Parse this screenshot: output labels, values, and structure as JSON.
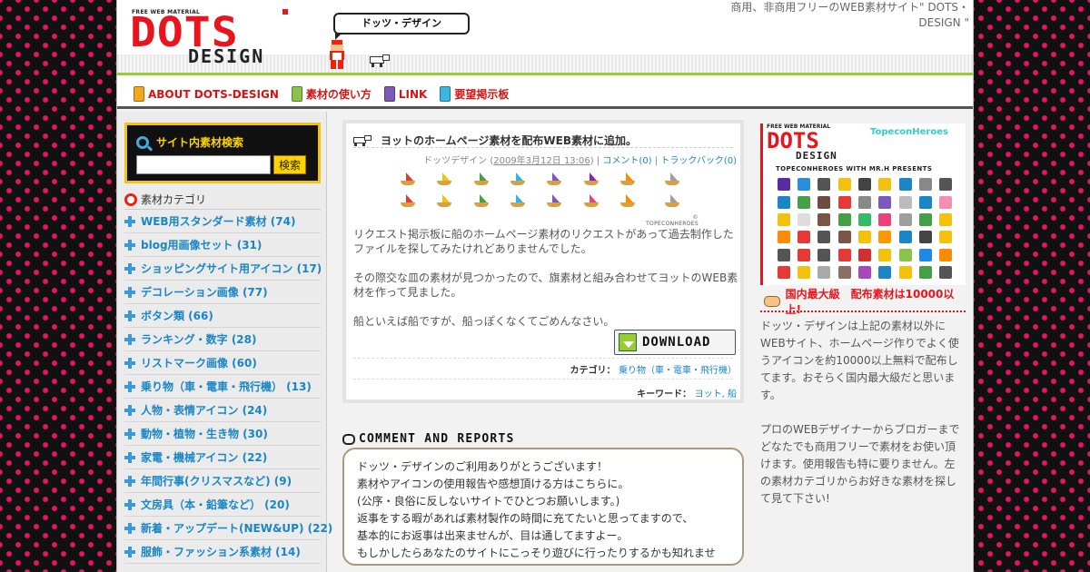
{
  "header": {
    "logo_small": "FREE WEB MATERIAL",
    "logo_main": "DOTS",
    "logo_sub": "DESIGN",
    "bubble": "ドッツ・デザイン",
    "tagline": "商用、非商用フリーのWEB素材サイト\" DOTS・DESIGN \""
  },
  "nav": [
    {
      "label": "ABOUT DOTS-DESIGN",
      "color": "#f2a81c"
    },
    {
      "label": "素材の使い方",
      "color": "#8bc34a"
    },
    {
      "label": "LINK",
      "color": "#7d5ab5"
    },
    {
      "label": "要望掲示板",
      "color": "#3cb5e0"
    }
  ],
  "sidebar": {
    "search_title": "サイト内素材検索",
    "search_value": "",
    "search_button": "検索",
    "category_title": "素材カテゴリ",
    "categories": [
      "WEB用スタンダード素材 (74)",
      "blog用画像セット (31)",
      "ショッピングサイト用アイコン (17)",
      "デコレーション画像 (77)",
      "ボタン類 (66)",
      "ランキング・数字 (28)",
      "リストマーク画像 (60)",
      "乗り物（車・電車・飛行機） (13)",
      "人物・表情アイコン (24)",
      "動物・植物・生き物 (30)",
      "家電・機械アイコン (22)",
      "年間行事(クリスマスなど) (9)",
      "文房具（本・鉛筆など） (20)",
      "新着・アップデート(NEW&UP) (22)",
      "服飾・ファッション系素材 (14)"
    ]
  },
  "post": {
    "title": "ヨットのホームページ素材を配布WEB素材に追加。",
    "author": "ドッツデザイン",
    "date": "2009年3月12日 13:06",
    "comments": "コメント(0)",
    "trackback": "トラックバック(0)",
    "boats_credit": "© TOPECONHEROES",
    "boats": [
      "#e53935",
      "#f4c20d",
      "#43a047",
      "#29b6f6",
      "#7e57c2",
      "#8e24aa",
      "#fb8c00",
      "#9e9e9e",
      "#e53935",
      "#f4c20d",
      "#43a047",
      "#29b6f6",
      "#7e57c2",
      "#ec407a",
      "#fb8c00",
      "#9e9e9e"
    ],
    "paragraphs": [
      "リクエスト掲示板に船のホームページ素材のリクエストがあって過去制作したファイルを探してみたけれどありませんでした。",
      "その際交な皿の素材が見つかったので、旗素材と組み合わせてヨットのWEB素材を作って見ました。",
      "船といえば船ですが、船っぽくなくてごめんなさい。"
    ],
    "download": "DOWNLOAD",
    "category_label": "カテゴリ：",
    "category_value": "乗り物（車・電車・飛行機）",
    "keyword_label": "キーワード：",
    "keywords": "ヨット, 船"
  },
  "comment": {
    "heading": "COMMENT AND REPORTS",
    "lines": [
      "ドッツ・デザインのご利用ありがとうございます！",
      "素材やアイコンの使用報告や感想頂ける方はこちらに。",
      "(公序・良俗に反しないサイトでひとつお願いします。)",
      "返事をする暇があれば素材製作の時間に充てたいと思ってますので、",
      "基本的にお返事は出来ませんが、目は通してますよー。",
      "もしかしたらあなたのサイトにこっそり遊びに行ったりするかも知れませ"
    ]
  },
  "right": {
    "banner_small": "FREE WEB MATERIAL",
    "banner_logo": "DOTS",
    "banner_sub": "DESIGN",
    "topecon": "TopeconHeroes",
    "presents": "TOPECONHEROES WITH MR.H PRESENTS",
    "icon_colors": [
      "#5b2ca0",
      "#2a8fd8",
      "#555",
      "#f4c20d",
      "#444",
      "#f4c20d",
      "#1a86c6",
      "#888",
      "#555",
      "#1a86c6",
      "#43a047",
      "#6d4c41",
      "#e53935",
      "#888",
      "#7e57c2",
      "#bbb",
      "#1a86c6",
      "#f48fb1",
      "#f4c20d",
      "#ddd",
      "#795548",
      "#43a047",
      "#3b6",
      "#ec407a",
      "#9e9e9e",
      "#43a047",
      "#f4c20d",
      "#fb8c00",
      "#e53935",
      "#555",
      "#795548",
      "#f4c20d",
      "#ff9800",
      "#1a86c6",
      "#444",
      "#f4c20d",
      "#555",
      "#e53935",
      "#555",
      "#e53935",
      "#d32f2f",
      "#f4c20d",
      "#8bc34a",
      "#1e88e5",
      "#fb8c00",
      "#e53935",
      "#f4c20d",
      "#aaa",
      "#8d6e63",
      "#ab47bc",
      "#1a86c6",
      "#f4c20d",
      "#43a047",
      "#555"
    ],
    "biggest": "国内最大級　配布素材は10000以上!",
    "paragraphs": [
      "ドッツ・デザインは上記の素材以外にWEBサイト、ホームページ作りでよく使うアイコンを約10000以上無料で配布してます。おそらく国内最大級だと思います。",
      "プロのWEBデザイナーからブロガーまでどなたでも商用フリーで素材をお使い頂けます。使用報告も特に要りません。左の素材カテゴリからお好きな素材を探して見て下さい!"
    ]
  }
}
